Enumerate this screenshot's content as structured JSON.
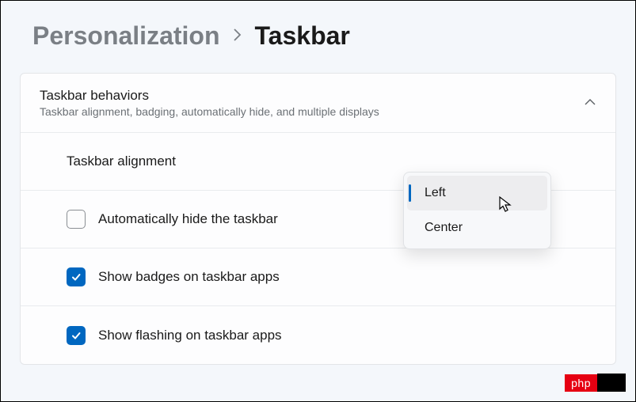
{
  "breadcrumb": {
    "parent": "Personalization",
    "current": "Taskbar"
  },
  "panel": {
    "title": "Taskbar behaviors",
    "subtitle": "Taskbar alignment, badging, automatically hide, and multiple displays"
  },
  "rows": {
    "alignment_label": "Taskbar alignment",
    "auto_hide_label": "Automatically hide the taskbar",
    "badges_label": "Show badges on taskbar apps",
    "flashing_label": "Show flashing on taskbar apps"
  },
  "dropdown": {
    "option_left": "Left",
    "option_center": "Center"
  },
  "watermark": {
    "text": "php"
  }
}
